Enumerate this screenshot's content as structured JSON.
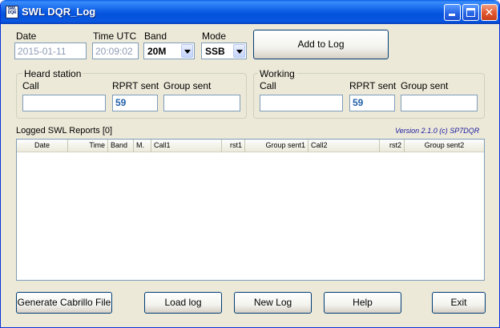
{
  "window": {
    "title": "SWL DQR_Log",
    "icon_text": "SWL DQR"
  },
  "top": {
    "date_label": "Date",
    "date_value": "2015-01-11",
    "time_label": "Time UTC",
    "time_value": "20:09:02",
    "band_label": "Band",
    "band_value": "20M",
    "mode_label": "Mode",
    "mode_value": "SSB",
    "add_label": "Add to Log"
  },
  "heard": {
    "title": "Heard  station",
    "call_label": "Call",
    "call_value": "",
    "rprt_label": "RPRT sent",
    "rprt_value": "59",
    "group_label": "Group sent",
    "group_value": ""
  },
  "working": {
    "title": "Working",
    "call_label": "Call",
    "call_value": "",
    "rprt_label": "RPRT sent",
    "rprt_value": "59",
    "group_label": "Group sent",
    "group_value": ""
  },
  "log": {
    "title": "Logged SWL Reports  [0]",
    "version": "Version 2.1.0 (c) SP7DQR",
    "columns": [
      "Date",
      "Time",
      "Band",
      "M.",
      "Call1",
      "rst1",
      "Group sent1",
      "Call2",
      "rst2",
      "Group sent2"
    ]
  },
  "buttons": {
    "cabrillo": "Generate Cabrillo File",
    "load": "Load log",
    "new": "New Log",
    "help": "Help",
    "exit": "Exit"
  }
}
